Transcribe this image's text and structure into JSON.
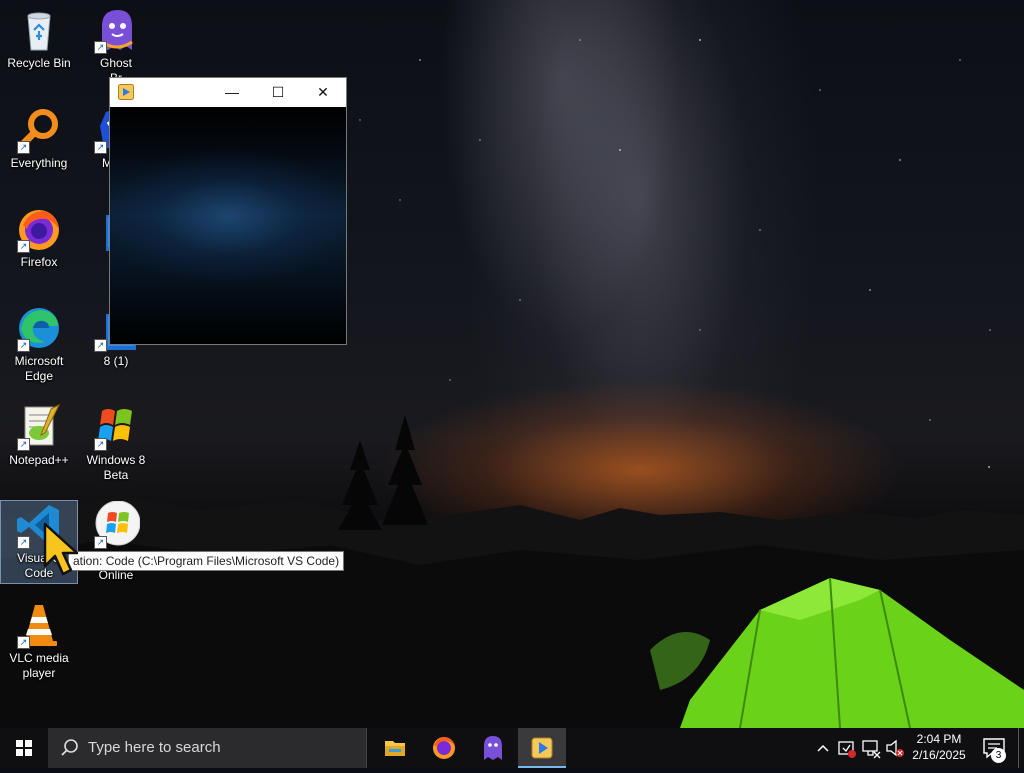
{
  "desktop_icons": [
    {
      "name": "recycle-bin",
      "label": "Recycle Bin"
    },
    {
      "name": "ghost-browser",
      "label": "Ghost\nBr"
    },
    {
      "name": "everything",
      "label": "Everything"
    },
    {
      "name": "malwarebytes",
      "label": "Malw"
    },
    {
      "name": "firefox",
      "label": "Firefox"
    },
    {
      "name": "windows-shortcut",
      "label": ""
    },
    {
      "name": "microsoft-edge",
      "label": "Microsoft\nEdge"
    },
    {
      "name": "windows-8-1",
      "label": "8 (1)"
    },
    {
      "name": "notepad-plus-plus",
      "label": "Notepad++"
    },
    {
      "name": "windows-8-beta",
      "label": "Windows 8\nBeta"
    },
    {
      "name": "visual-studio-code",
      "label": "Visual S\nCode"
    },
    {
      "name": "windows-online",
      "label": "Online"
    },
    {
      "name": "vlc-media-player",
      "label": "VLC media\nplayer"
    }
  ],
  "tooltip": {
    "text": "ation: Code (C:\\Program Files\\Microsoft VS Code)"
  },
  "vlc_window": {
    "minimize_glyph": "—",
    "maximize_glyph": "☐",
    "close_glyph": "✕"
  },
  "taskbar": {
    "search_placeholder": "Type here to search",
    "apps": [
      "file-explorer",
      "firefox",
      "ghost-browser",
      "vlc-media-player"
    ],
    "time": "2:04 PM",
    "date": "2/16/2025",
    "notification_count": "3",
    "tray_chevron": "^"
  },
  "colors": {
    "taskbar_bg": "#0f0f12",
    "active_underline": "#76b9ed",
    "selection": "#78a0d2"
  }
}
